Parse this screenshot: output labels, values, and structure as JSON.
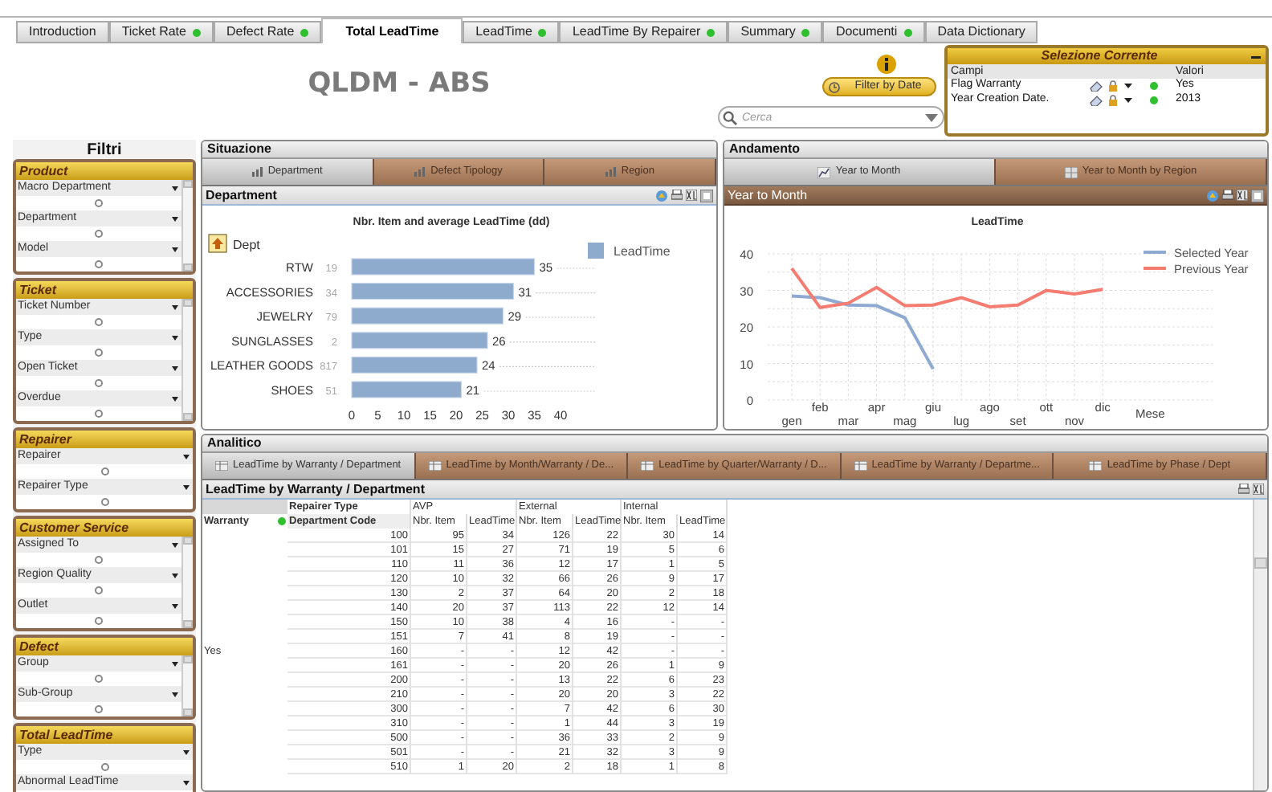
{
  "tabs": [
    {
      "label": "Introduction",
      "selected": false,
      "indicator": false
    },
    {
      "label": "Ticket Rate",
      "selected": false,
      "indicator": true
    },
    {
      "label": "Defect Rate",
      "selected": false,
      "indicator": true
    },
    {
      "label": "Total LeadTime",
      "selected": true,
      "indicator": false
    },
    {
      "label": "LeadTime",
      "selected": false,
      "indicator": true
    },
    {
      "label": "LeadTime By Repairer",
      "selected": false,
      "indicator": true
    },
    {
      "label": "Summary",
      "selected": false,
      "indicator": true
    },
    {
      "label": "Documenti",
      "selected": false,
      "indicator": true
    },
    {
      "label": "Data Dictionary",
      "selected": false,
      "indicator": false
    }
  ],
  "header": {
    "title": "QLDM - ABS",
    "filter_button": "Filter by Date",
    "search": {
      "placeholder": "Cerca"
    }
  },
  "current_selection": {
    "title": "Selezione Corrente",
    "columns": [
      "Campi",
      "Valori"
    ],
    "rows": [
      {
        "field": "Flag Warranty",
        "value": "Yes"
      },
      {
        "field": "Year Creation Date.",
        "value": "2013"
      }
    ]
  },
  "filters": {
    "title": "Filtri",
    "groups": [
      {
        "title": "Product",
        "scrollbar": true,
        "items": [
          "Macro Department",
          "Department",
          "Model"
        ]
      },
      {
        "title": "Ticket",
        "scrollbar": true,
        "items": [
          "Ticket Number",
          "Type",
          "Open Ticket",
          "Overdue"
        ]
      },
      {
        "title": "Repairer",
        "scrollbar": false,
        "items": [
          "Repairer",
          "Repairer Type"
        ]
      },
      {
        "title": "Customer Service",
        "scrollbar": true,
        "items": [
          "Assigned To",
          "Region Quality",
          "Outlet"
        ]
      },
      {
        "title": "Defect",
        "scrollbar": true,
        "items": [
          "Group",
          "Sub-Group"
        ]
      },
      {
        "title": "Total LeadTime",
        "scrollbar": false,
        "items": [
          "Type",
          "Abnormal LeadTime"
        ]
      }
    ]
  },
  "situazione": {
    "title": "Situazione",
    "tabs": [
      {
        "label": "Department",
        "selected": true
      },
      {
        "label": "Defect Tipology",
        "selected": false
      },
      {
        "label": "Region",
        "selected": false
      }
    ],
    "panel_title": "Department",
    "dept_label": "Dept",
    "item_counts": [
      "19",
      "34",
      "79",
      "2",
      "817",
      "51"
    ],
    "chart_data": {
      "type": "bar",
      "orientation": "horizontal",
      "title": "Nbr. Item and average LeadTime (dd)",
      "categories": [
        "RTW",
        "ACCESSORIES",
        "JEWELRY",
        "SUNGLASSES",
        "LEATHER GOODS",
        "SHOES"
      ],
      "series": [
        {
          "name": "LeadTime",
          "color": "#8eaacc",
          "values": [
            35,
            31,
            29,
            26,
            24,
            21
          ]
        }
      ],
      "xticks": [
        0,
        5,
        10,
        15,
        20,
        25,
        30,
        35,
        40
      ],
      "xlim": [
        0,
        40
      ],
      "data_labels": true
    }
  },
  "andamento": {
    "title": "Andamento",
    "tabs": [
      {
        "label": "Year to Month",
        "selected": true
      },
      {
        "label": "Year to Month by Region",
        "selected": false
      }
    ],
    "panel_title": "Year to Month",
    "chart_data": {
      "type": "line",
      "title": "LeadTime",
      "xlabel": "Mese",
      "x": [
        "gen",
        "feb",
        "mar",
        "apr",
        "mag",
        "giu",
        "lug",
        "ago",
        "set",
        "ott",
        "nov",
        "dic"
      ],
      "series": [
        {
          "name": "Selected Year",
          "color": "#8eaad2",
          "values": [
            28.5,
            28,
            26,
            25.8,
            22.5,
            8.5,
            null,
            null,
            null,
            null,
            null,
            null
          ]
        },
        {
          "name": "Previous Year",
          "color": "#f47c70",
          "values": [
            36,
            25.3,
            26.5,
            30.8,
            25.8,
            26,
            28,
            25.5,
            26,
            30,
            29,
            30.3
          ]
        }
      ],
      "ylim": [
        0,
        40
      ],
      "yticks": [
        0,
        10,
        20,
        30,
        40
      ],
      "grid": true,
      "legend": true
    }
  },
  "analitico": {
    "title": "Analitico",
    "tabs": [
      {
        "label": "LeadTime by Warranty / Department",
        "selected": true
      },
      {
        "label": "LeadTime by Month/Warranty / De...",
        "selected": false
      },
      {
        "label": "LeadTime by Quarter/Warranty / D...",
        "selected": false
      },
      {
        "label": "LeadTime by Warranty / Departme...",
        "selected": false
      },
      {
        "label": "LeadTime by Phase / Dept",
        "selected": false
      }
    ],
    "panel_title": "LeadTime by Warranty / Department",
    "table": {
      "group_header": "Repairer Type",
      "groups": [
        "AVP",
        "External",
        "Internal"
      ],
      "row_header": "Warranty",
      "code_header": "Department Code",
      "subcolumns": [
        "Nbr. Item",
        "LeadTime",
        "Nbr. Item",
        "LeadTime",
        "Nbr. Item",
        "LeadTime"
      ],
      "warranty": "Yes",
      "rows": [
        [
          "100",
          "95",
          "34",
          "126",
          "22",
          "30",
          "14"
        ],
        [
          "101",
          "15",
          "27",
          "71",
          "19",
          "5",
          "6"
        ],
        [
          "110",
          "11",
          "36",
          "12",
          "17",
          "1",
          "5"
        ],
        [
          "120",
          "10",
          "32",
          "66",
          "26",
          "9",
          "17"
        ],
        [
          "130",
          "2",
          "37",
          "64",
          "20",
          "2",
          "18"
        ],
        [
          "140",
          "20",
          "37",
          "113",
          "22",
          "12",
          "14"
        ],
        [
          "150",
          "10",
          "38",
          "4",
          "16",
          "-",
          "-"
        ],
        [
          "151",
          "7",
          "41",
          "8",
          "19",
          "-",
          "-"
        ],
        [
          "160",
          "-",
          "-",
          "12",
          "42",
          "-",
          "-"
        ],
        [
          "161",
          "-",
          "-",
          "20",
          "26",
          "1",
          "9"
        ],
        [
          "200",
          "-",
          "-",
          "13",
          "22",
          "6",
          "23"
        ],
        [
          "210",
          "-",
          "-",
          "20",
          "20",
          "3",
          "22"
        ],
        [
          "300",
          "-",
          "-",
          "7",
          "42",
          "6",
          "30"
        ],
        [
          "310",
          "-",
          "-",
          "1",
          "44",
          "3",
          "19"
        ],
        [
          "500",
          "-",
          "-",
          "36",
          "33",
          "2",
          "9"
        ],
        [
          "501",
          "-",
          "-",
          "21",
          "32",
          "3",
          "9"
        ],
        [
          "510",
          "1",
          "20",
          "2",
          "18",
          "1",
          "8"
        ]
      ]
    }
  }
}
